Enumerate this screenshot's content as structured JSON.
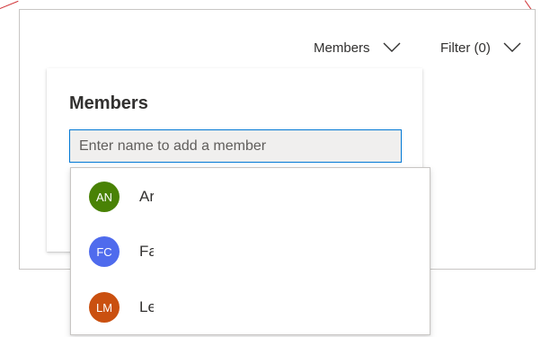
{
  "toolbar": {
    "members_label": "Members",
    "filter_label": "Filter (0)"
  },
  "callout": {
    "title": "Members",
    "search_placeholder": "Enter name to add a member"
  },
  "suggestions": [
    {
      "initials": "AN",
      "name": "Ar",
      "color": "#498205"
    },
    {
      "initials": "FC",
      "name": "Fa",
      "color": "#4f6bed"
    },
    {
      "initials": "LM",
      "name": "Le",
      "color": "#ca5010"
    }
  ],
  "colors": {
    "accent": "#0078d4",
    "annotation": "#d13438"
  }
}
